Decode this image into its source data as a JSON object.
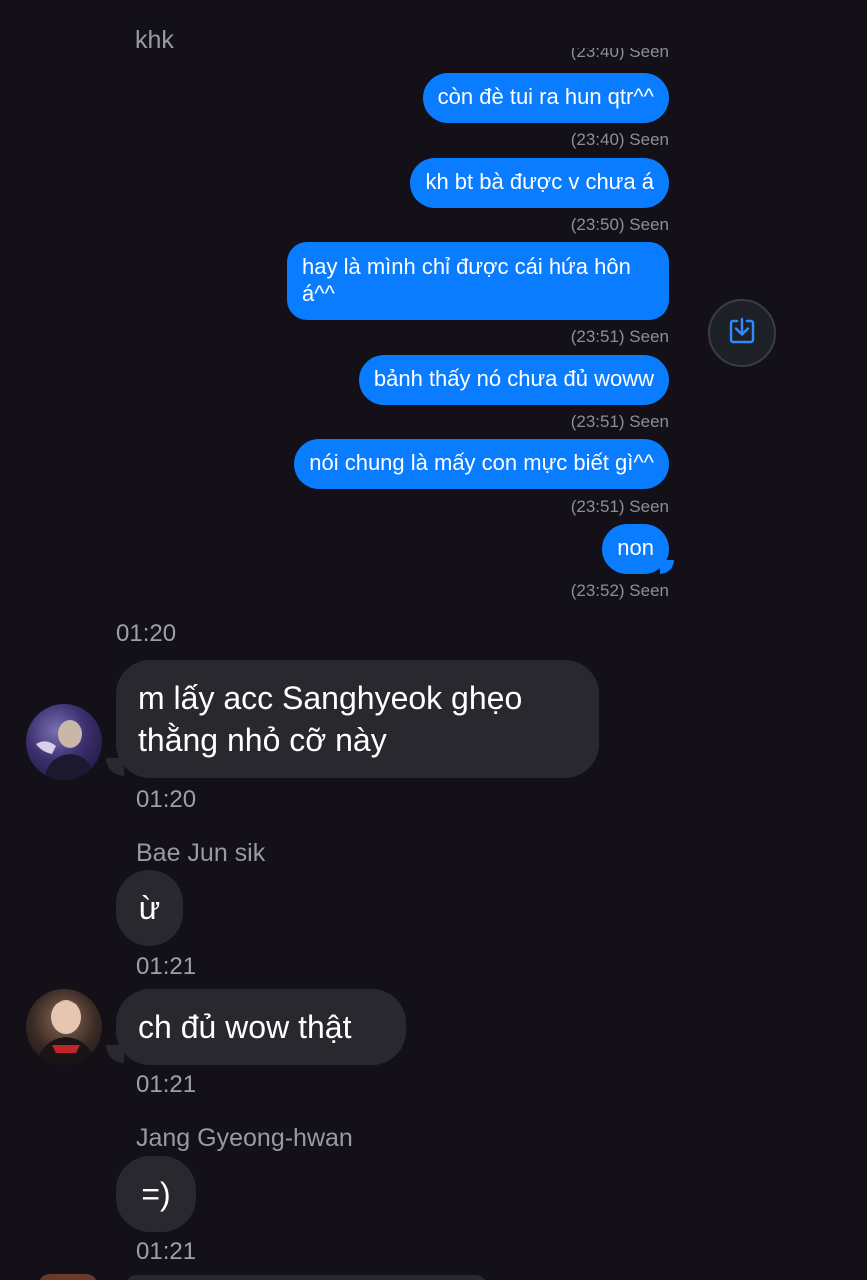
{
  "top_sender": "khk",
  "outgoing": [
    {
      "text": "còn đè tui ra hun qtr^^",
      "status": "(23:40) Seen"
    },
    {
      "text": "kh bt bà được v chưa á",
      "status": "(23:50) Seen"
    },
    {
      "text": "hay là mình chỉ được cái hứa hôn á^^",
      "status": "(23:51) Seen"
    },
    {
      "text": "bảnh thấy nó chưa đủ woww",
      "status": "(23:51) Seen"
    },
    {
      "text": "nói chung là mấy con mực biết gì^^",
      "status": "(23:51) Seen"
    },
    {
      "text": "non",
      "status": "(23:52) Seen"
    }
  ],
  "cutoff_status": "(23:40) Seen",
  "time_separator": "01:20",
  "incoming": [
    {
      "sender": "",
      "text_lines": [
        "m lấy acc Sanghyeok ghẹo",
        "thằng nhỏ cỡ này"
      ],
      "time": "01:20"
    },
    {
      "sender": "Bae Jun sik",
      "text_lines": [
        "ừ"
      ],
      "time": "01:21"
    },
    {
      "sender": "",
      "text_lines": [
        "ch đủ wow thật"
      ],
      "time": "01:21"
    },
    {
      "sender": "Jang Gyeong-hwan",
      "text_lines": [
        "=)"
      ],
      "time": "01:21"
    }
  ],
  "icons": {
    "save": "save-download-icon"
  },
  "colors": {
    "outgoing_bubble": "#0a7cff",
    "incoming_bubble": "#2a282f",
    "background": "#131018"
  }
}
